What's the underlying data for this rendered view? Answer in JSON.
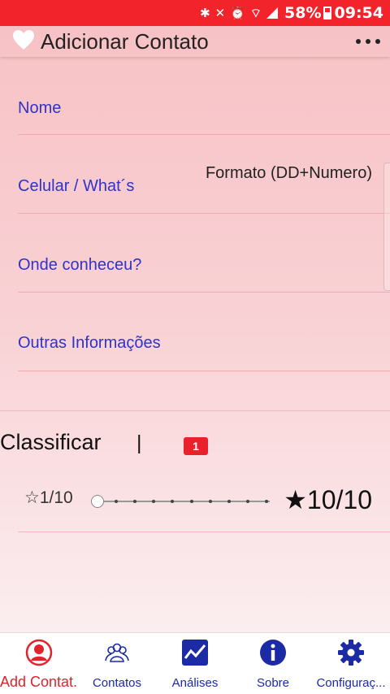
{
  "status_bar": {
    "battery": "58%",
    "time": "09:54"
  },
  "appbar": {
    "title": "Adicionar Contato"
  },
  "form": {
    "fields": [
      {
        "label": "Nome"
      },
      {
        "label": "Celular / What´s",
        "hint": "Formato (DD+Numero)"
      },
      {
        "label": "Onde conheceu?"
      },
      {
        "label": "Outras Informações"
      }
    ]
  },
  "classify": {
    "title": "Classificar",
    "separator": "|",
    "badge": "1"
  },
  "rating": {
    "min_label": "☆1/10",
    "max_label": "★10/10",
    "value": 1,
    "min": 1,
    "max": 10
  },
  "bottom_nav": {
    "items": [
      {
        "label": "Add Contat..",
        "icon": "person-add-icon",
        "active": true
      },
      {
        "label": "Contatos",
        "icon": "contacts-group-icon"
      },
      {
        "label": "Análises",
        "icon": "chart-icon"
      },
      {
        "label": "Sobre",
        "icon": "info-icon"
      },
      {
        "label": "Configuraç...",
        "icon": "gear-icon"
      }
    ]
  },
  "colors": {
    "status_bar": "#f2232b",
    "field_label": "#2f33c8",
    "nav_label": "#1c2aa6",
    "active": "#e2232c"
  }
}
